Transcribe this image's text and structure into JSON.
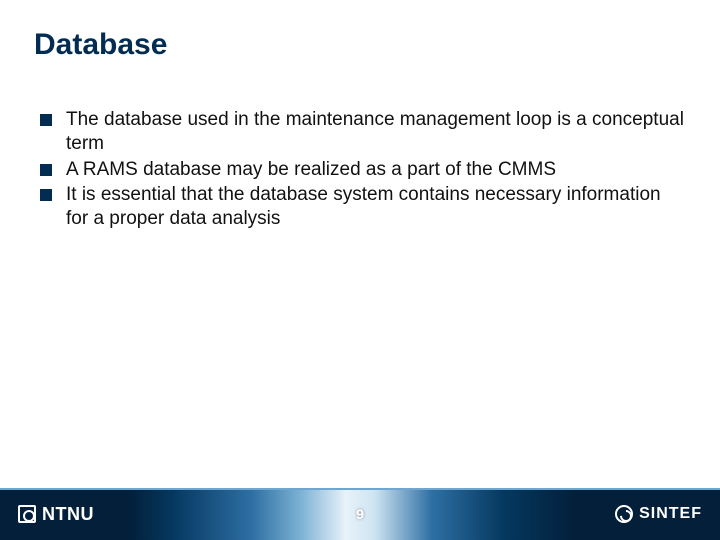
{
  "title": "Database",
  "bullets": [
    "The database used in the maintenance management loop is a conceptual term",
    "A RAMS database may be realized as a part of the CMMS",
    "It is essential that the database system contains necessary information for a proper data analysis"
  ],
  "page_number": "9",
  "footer": {
    "left_logo_text": "NTNU",
    "right_logo_text": "SINTEF"
  }
}
